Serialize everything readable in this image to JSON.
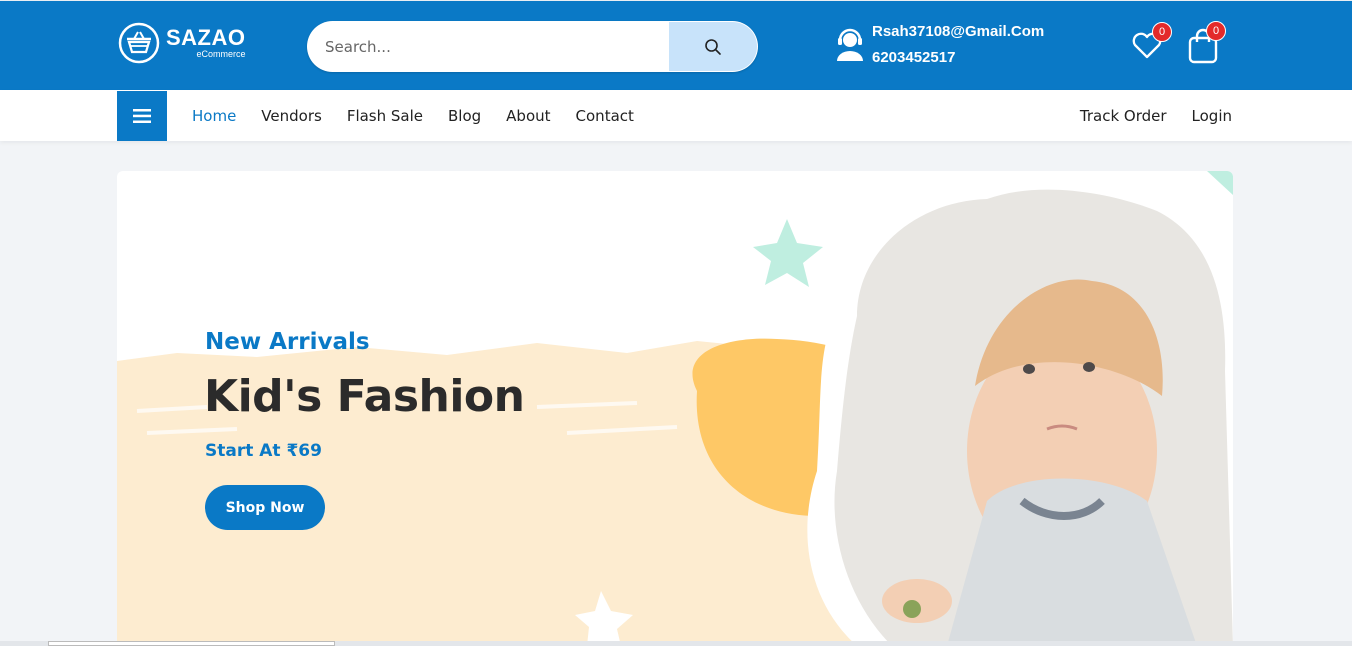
{
  "brand": {
    "name": "SAZAO",
    "tagline": "eCommerce"
  },
  "search": {
    "placeholder": "Search...",
    "button_icon": "search-icon"
  },
  "contact": {
    "email": "Rsah37108@Gmail.Com",
    "phone": "6203452517",
    "icon": "support-agent-icon"
  },
  "header_icons": {
    "wishlist_count": "0",
    "cart_count": "0"
  },
  "nav": {
    "menu_icon": "hamburger-icon",
    "links": [
      {
        "label": "Home",
        "active": true
      },
      {
        "label": "Vendors"
      },
      {
        "label": "Flash Sale"
      },
      {
        "label": "Blog"
      },
      {
        "label": "About"
      },
      {
        "label": "Contact"
      }
    ],
    "right_links": [
      {
        "label": "Track Order"
      },
      {
        "label": "Login"
      }
    ]
  },
  "hero": {
    "kicker": "New Arrivals",
    "title": "Kid's Fashion",
    "price_line": "Start At ₹69",
    "cta": "Shop Now"
  },
  "colors": {
    "primary": "#0a79c6",
    "accent_light": "#c8e3fa",
    "badge": "#e32a2a",
    "hero_cream": "#fdecd0",
    "hero_yellow": "#fec866",
    "hero_mint": "#bfeee0"
  }
}
